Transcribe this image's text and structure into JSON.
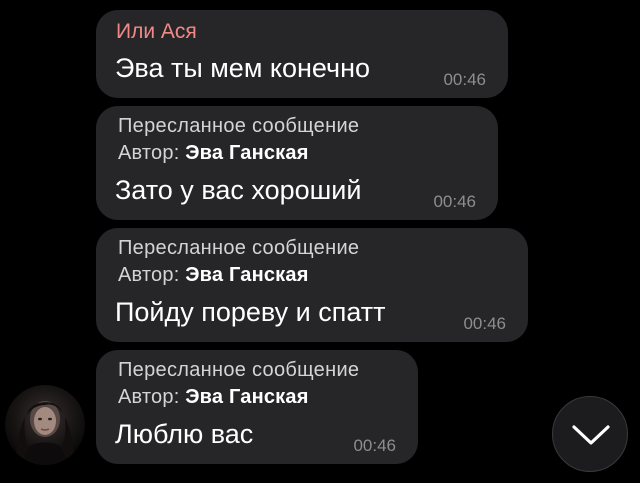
{
  "messages": [
    {
      "sender": "Или Ася",
      "text": "Эва ты мем конечно",
      "time": "00:46"
    },
    {
      "forwarded_label": "Пересланное сообщение",
      "author_prefix": "Автор:",
      "author_name": "Эва Ганская",
      "text": "Зато у вас хороший",
      "time": "00:46"
    },
    {
      "forwarded_label": "Пересланное сообщение",
      "author_prefix": "Автор:",
      "author_name": "Эва Ганская",
      "text": "Пойду пореву и спатт",
      "time": "00:46"
    },
    {
      "forwarded_label": "Пересланное сообщение",
      "author_prefix": "Автор:",
      "author_name": "Эва Ганская",
      "text": "Люблю вас",
      "time": "00:46"
    }
  ],
  "icons": {
    "scroll_down": "chevron-down-icon",
    "avatar": "user-avatar"
  },
  "colors": {
    "background": "#000000",
    "bubble": "#262628",
    "sender_name": "#f08a86",
    "secondary_text": "#d4d4d6",
    "timestamp": "#8d8d92"
  }
}
